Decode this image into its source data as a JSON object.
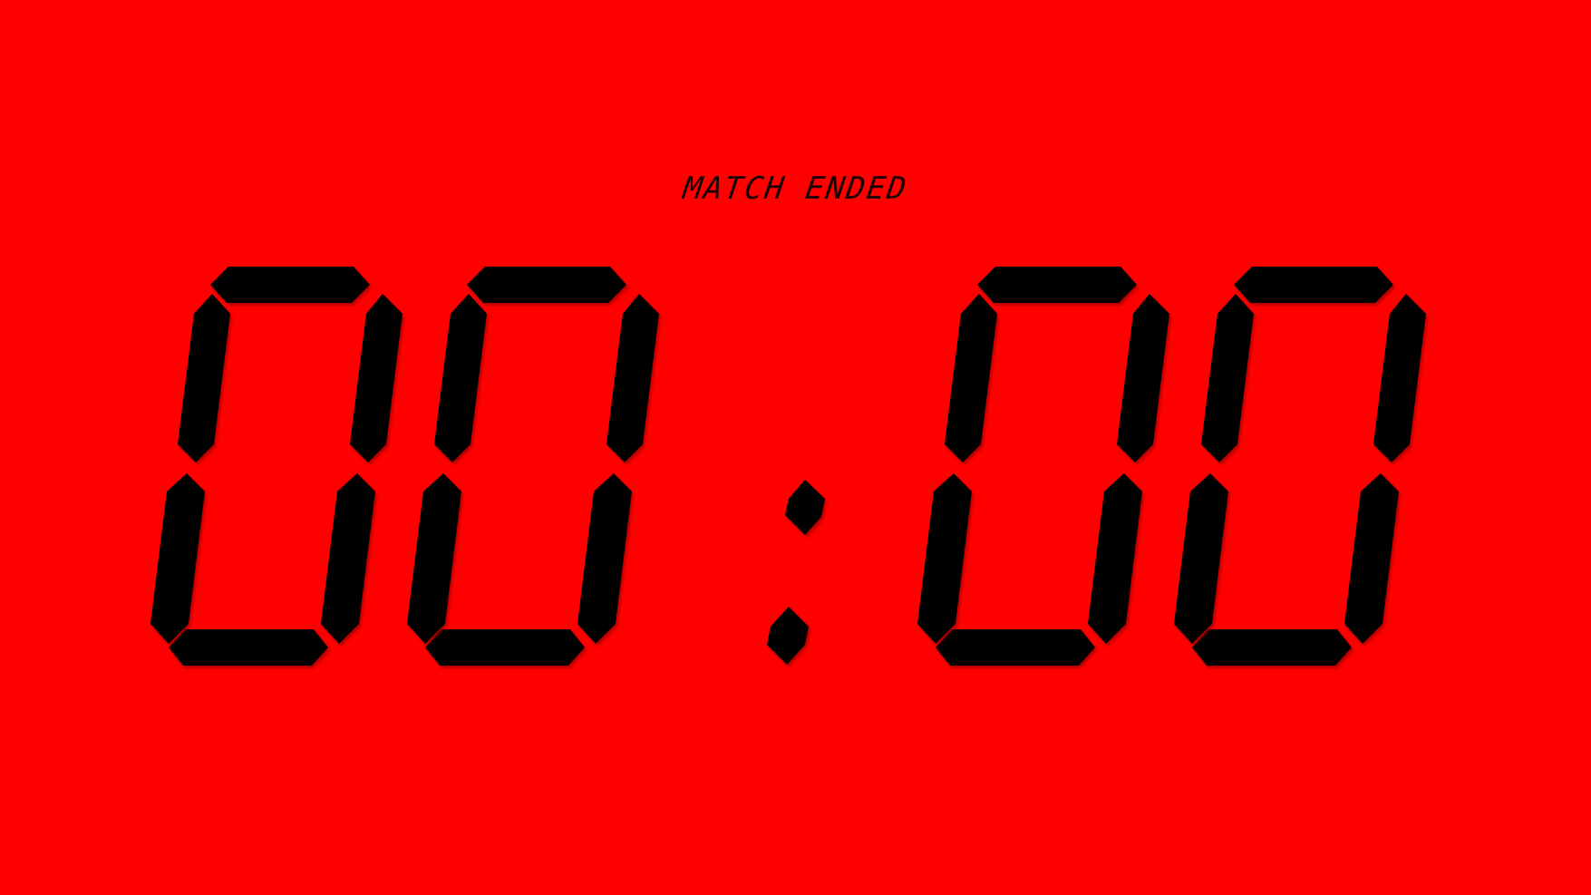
{
  "status_label": "MATCH ENDED",
  "timer": {
    "display": "00:00",
    "minutes": "00",
    "seconds": "00"
  },
  "colors": {
    "background": "#ff0000",
    "segment": "#000000"
  }
}
